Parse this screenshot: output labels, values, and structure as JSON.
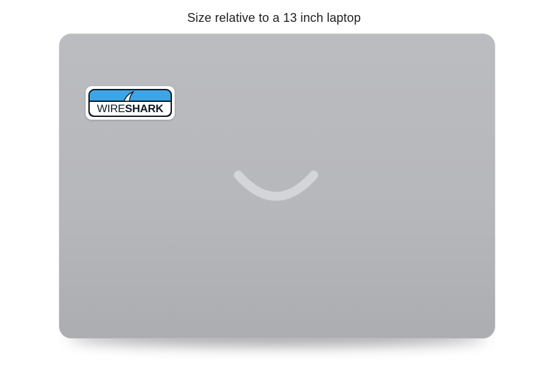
{
  "caption": "Size relative to a 13 inch laptop",
  "sticker": {
    "brand_light": "WIRE",
    "brand_bold": "SHARK",
    "icon": "shark-fin-icon"
  },
  "colors": {
    "lid": "#b8b9bd",
    "smile": "#d3d5d8",
    "sticker_blue": "#3da5e6",
    "sticker_text": "#0e1a24"
  }
}
